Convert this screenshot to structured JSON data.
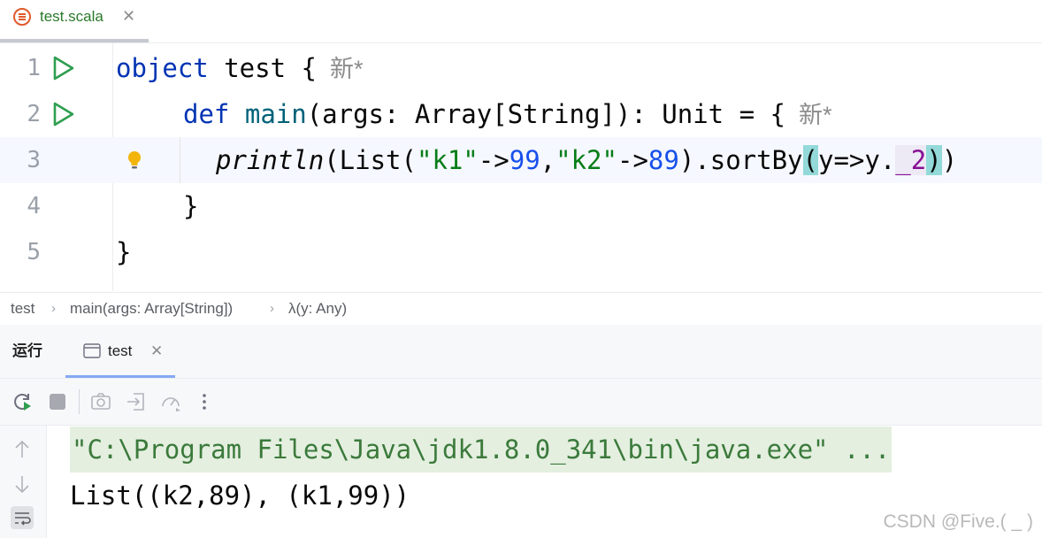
{
  "editor_tab": {
    "title": "test.scala",
    "close": "✕"
  },
  "editor": {
    "lines": [
      {
        "number": "1"
      },
      {
        "number": "2"
      },
      {
        "number": "3"
      },
      {
        "number": "4"
      },
      {
        "number": "5"
      }
    ],
    "code": {
      "l1_kw": "object",
      "l1_name": " test ",
      "l1_brace": "{",
      "l1_hint": "  新*",
      "l2_kw": "def",
      "l2_fn": "main",
      "l2_params": "(args: Array[String]): Unit = {",
      "l2_hint": "  新*",
      "l3_fn": "println",
      "l3_a": "(List(",
      "l3_s1": "\"k1\"",
      "l3_arrow1": "->",
      "l3_n1": "99",
      "l3_comma": ",",
      "l3_s2": "\"k2\"",
      "l3_arrow2": "->",
      "l3_n2": "89",
      "l3_b": ").sortBy",
      "l3_open": "(",
      "l3_lambda": "y=>y.",
      "l3_field": "_2",
      "l3_close": ")",
      "l3_end": ")",
      "l4": "}",
      "l5": "}"
    }
  },
  "breadcrumb": {
    "items": [
      "test",
      "main(args: Array[String])",
      "λ(y: Any)"
    ],
    "separator": "›"
  },
  "run_window": {
    "title": "运行",
    "tab_label": "test",
    "tab_close": "✕"
  },
  "console": {
    "command": "\"C:\\Program Files\\Java\\jdk1.8.0_341\\bin\\java.exe\" ...",
    "result": "List((k2,89), (k1,99))"
  },
  "watermark": "CSDN @Five.(   _  )",
  "colors": {
    "keyword": "#0033b3",
    "string": "#067d17",
    "number": "#1750eb",
    "run_green": "#2e9e4f",
    "bracket_match": "#93d9d9"
  },
  "icons": {
    "run_gutter": "play-icon",
    "intention": "lightbulb-icon",
    "rerun": "rerun-icon",
    "stop": "stop-icon",
    "screenshot": "camera-icon",
    "export": "export-icon",
    "coverage": "gauge-icon",
    "more": "more-vertical-icon",
    "up": "arrow-up-icon",
    "down": "arrow-down-icon",
    "wrap": "soft-wrap-icon"
  }
}
